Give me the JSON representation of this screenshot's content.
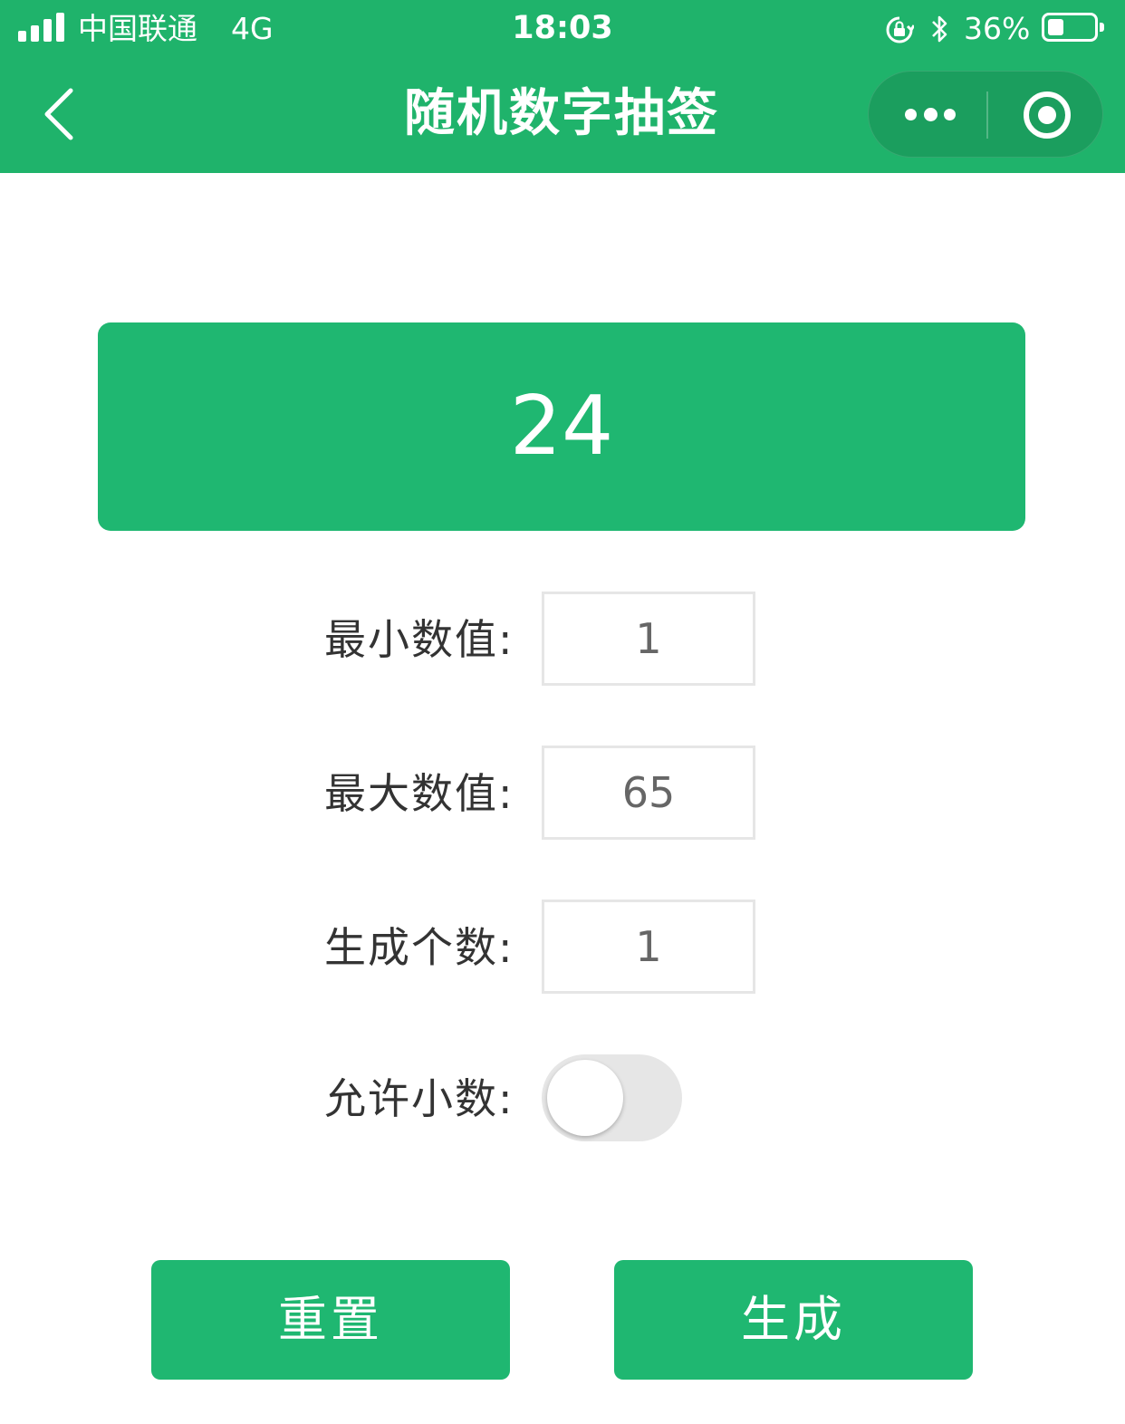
{
  "status_bar": {
    "carrier": "中国联通",
    "network": "4G",
    "time": "18:03",
    "battery_percent": "36%",
    "battery_level": 0.36
  },
  "nav_bar": {
    "title": "随机数字抽签",
    "back_icon": "chevron-left-icon",
    "menu_icon": "more-dots-icon",
    "close_icon": "target-circle-icon"
  },
  "result": {
    "value": "24"
  },
  "form": {
    "min_label": "最小数值:",
    "min_value": "1",
    "max_label": "最大数值:",
    "max_value": "65",
    "count_label": "生成个数:",
    "count_value": "1",
    "decimal_label": "允许小数:",
    "decimal_enabled": false
  },
  "actions": {
    "reset_label": "重置",
    "generate_label": "生成"
  },
  "colors": {
    "accent": "#1fb36b",
    "button": "#1fb771",
    "input_border": "#e6e6e6",
    "toggle_off": "#e6e6e6"
  }
}
